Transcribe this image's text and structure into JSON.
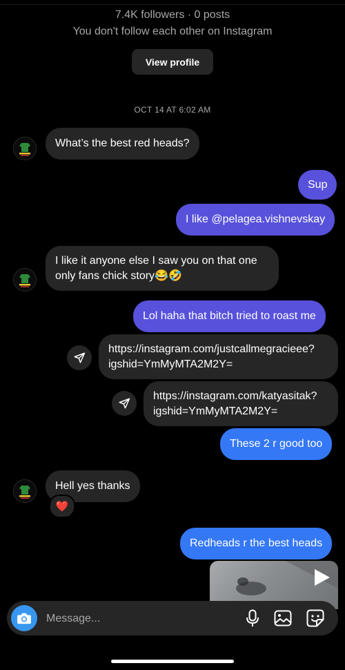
{
  "profile": {
    "stats": "7.4K followers · 0 posts",
    "relationship": "You don't follow each other on Instagram",
    "view_profile_label": "View profile"
  },
  "thread": {
    "timestamp": "OCT 14 AT 6:02 AM",
    "messages": [
      {
        "from": "them",
        "text": "What’s the best red heads?"
      },
      {
        "from": "me",
        "text": "Sup"
      },
      {
        "from": "me",
        "text": "I like @pelagea.vishnevskay"
      },
      {
        "from": "them",
        "line1": "I like it anyone else I saw you on that one",
        "line2": "only fans chick story😂🤣"
      },
      {
        "from": "me",
        "text": "Lol haha that bitch tried to roast me"
      },
      {
        "from": "me",
        "line1": "https://instagram.com/justcallmegracieee?",
        "line2": "igshid=YmMyMTA2M2Y="
      },
      {
        "from": "me",
        "line1": "https://instagram.com/katyasitak?",
        "line2": "igshid=YmMyMTA2M2Y="
      },
      {
        "from": "me",
        "text": "These 2 r good too"
      },
      {
        "from": "them",
        "text": "Hell yes thanks",
        "reaction": "❤️"
      },
      {
        "from": "me",
        "text": "Redheads r the best heads"
      }
    ]
  },
  "composer": {
    "placeholder": "Message..."
  },
  "icons": {
    "camera": "camera-icon",
    "microphone": "microphone-icon",
    "gallery": "gallery-icon",
    "sticker": "sticker-icon",
    "share": "share-icon",
    "play": "play-icon"
  },
  "colors": {
    "background": "#000000",
    "incoming_bubble": "#262626",
    "outgoing_bubble": "#5851db",
    "outgoing_bubble_blue": "#3478f6",
    "camera_button": "#3797f0",
    "secondary_text": "#a8a8a8"
  }
}
